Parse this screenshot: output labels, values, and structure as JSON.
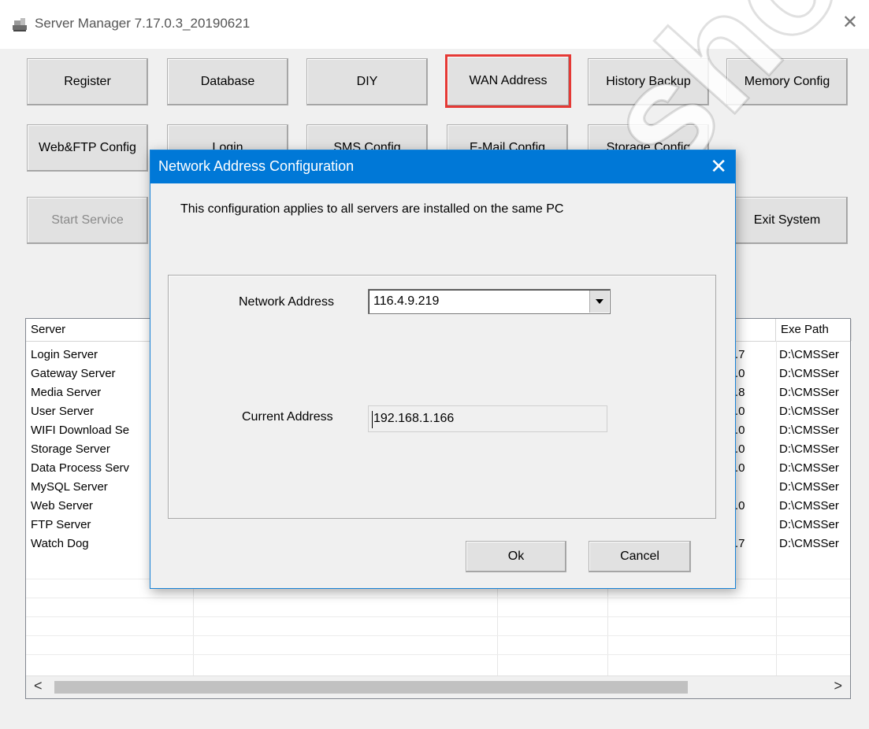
{
  "window": {
    "title": "Server Manager 7.17.0.3_20190621",
    "close_glyph": "✕"
  },
  "toolbar": {
    "row1": [
      "Register",
      "Database",
      "DIY",
      "WAN Address",
      "History Backup",
      "Memory Config"
    ],
    "row2": [
      "Web&FTP Config",
      "Login",
      "SMS Config",
      "E-Mail Config",
      "Storage Config"
    ],
    "row3": [
      "Start Service",
      "Exit System"
    ]
  },
  "table": {
    "headers": [
      "Server",
      "Exe Path"
    ],
    "servers": [
      "Login Server",
      "Gateway Server",
      "Media Server",
      "User Server",
      "WIFI Download Se",
      "Storage Server",
      "Data Process Serv",
      "MySQL Server",
      "Web Server",
      "FTP Server",
      "Watch Dog"
    ],
    "version_tails": [
      ".7",
      ".0",
      ".8",
      ".0",
      ".0",
      ".0",
      ".0",
      "",
      ".0",
      "",
      ".7"
    ],
    "exe_paths": [
      "D:\\CMSSer",
      "D:\\CMSSer",
      "D:\\CMSSer",
      "D:\\CMSSer",
      "D:\\CMSSer",
      "D:\\CMSSer",
      "D:\\CMSSer",
      "D:\\CMSSer",
      "D:\\CMSSer",
      "D:\\CMSSer",
      "D:\\CMSSer"
    ],
    "scroll_left": "<",
    "scroll_right": ">"
  },
  "dialog": {
    "title": "Network Address Configuration",
    "close_glyph": "✕",
    "note": "This configuration applies to all servers are installed on the same PC",
    "network_address_label": "Network Address",
    "network_address_value": "116.4.9.219",
    "current_address_label": "Current Address",
    "current_address_value": "192.168.1.166",
    "ok_label": "Ok",
    "cancel_label": "Cancel"
  },
  "watermark": "ka-shop",
  "colors": {
    "dialog_titlebar": "#0078d7",
    "highlight_border": "#e53935",
    "window_bg": "#f0f0f0"
  }
}
